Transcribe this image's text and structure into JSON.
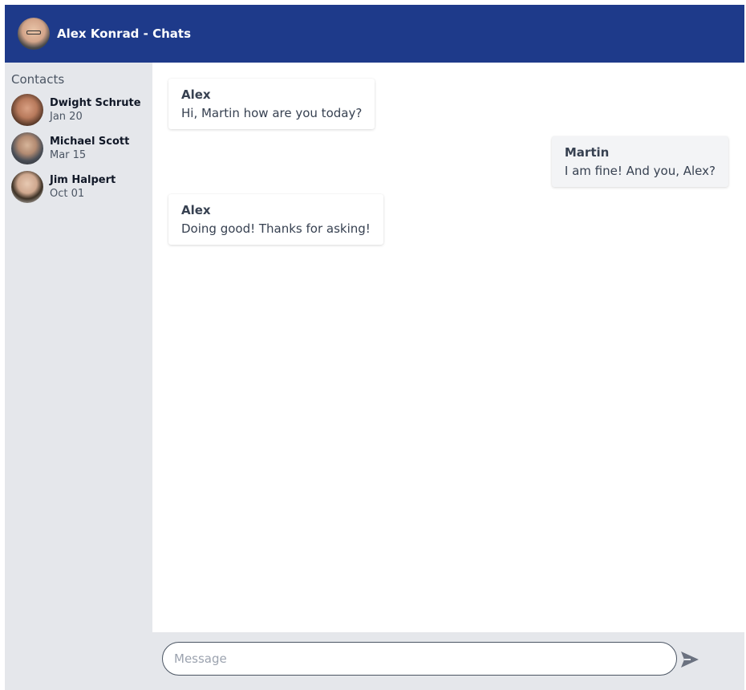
{
  "header": {
    "title": "Alex Konrad - Chats",
    "color": "#1e3a8a"
  },
  "sidebar": {
    "heading": "Contacts",
    "contacts": [
      {
        "name": "Dwight Schrute",
        "date": "Jan 20"
      },
      {
        "name": "Michael Scott",
        "date": "Mar 15"
      },
      {
        "name": "Jim Halpert",
        "date": "Oct 01"
      }
    ]
  },
  "messages": [
    {
      "author": "Alex",
      "text": "Hi, Martin how are you today?",
      "direction": "incoming"
    },
    {
      "author": "Martin",
      "text": "I am fine! And you, Alex?",
      "direction": "outgoing"
    },
    {
      "author": "Alex",
      "text": "Doing good! Thanks for asking!",
      "direction": "incoming"
    }
  ],
  "composer": {
    "placeholder": "Message",
    "value": "",
    "send_icon": "send-icon"
  }
}
